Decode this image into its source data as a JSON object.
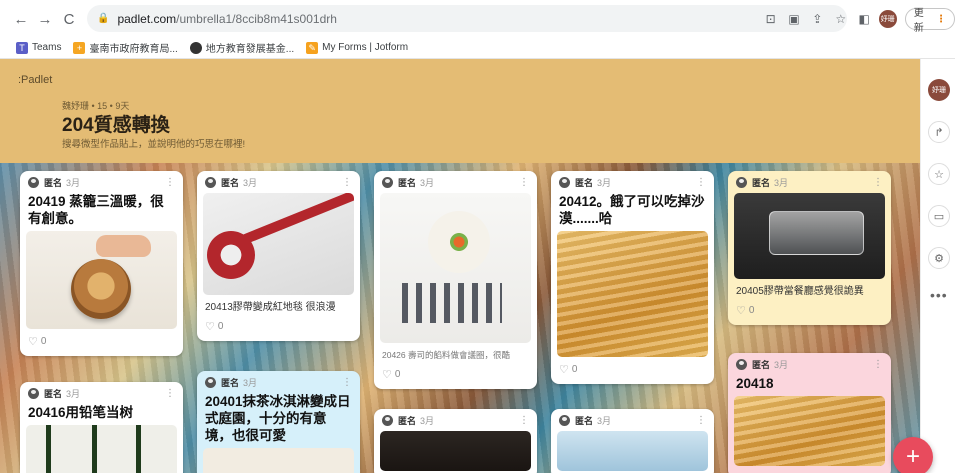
{
  "browser": {
    "url_host": "padlet.com",
    "url_path": "/umbrella1/8ccib8m41s001drh",
    "profile_label": "妤珊",
    "update_label": "更新",
    "bookmarks": [
      {
        "label": "Teams",
        "color": "#5b5fc7"
      },
      {
        "label": "臺南市政府教育局...",
        "color": "#f5a623"
      },
      {
        "label": "地方教育發展基金...",
        "color": "#333333"
      },
      {
        "label": "My Forms | Jotform",
        "color": "#f6a21e"
      }
    ]
  },
  "padlet": {
    "logo": ":Padlet",
    "meta": "魏妤珊 • 15 • 9天",
    "title": "204質感轉換",
    "subtitle": "搜尋微型作品貼上，並說明他的巧思在哪裡!",
    "rail_avatar": "妤珊",
    "fab": "+"
  },
  "cards": [
    {
      "author": "匿名",
      "time": "3月",
      "title": "20419 蒸籠三溫暖，很有創意。",
      "caption": "",
      "likes": "0"
    },
    {
      "author": "匿名",
      "time": "3月",
      "title": "",
      "caption": "20413膠帶變成紅地毯 很浪漫",
      "likes": "0"
    },
    {
      "author": "匿名",
      "time": "3月",
      "title": "",
      "caption": "20426 壽司的餡料做會議圈，很酷",
      "likes": "0"
    },
    {
      "author": "匿名",
      "time": "3月",
      "title": "20412。餓了可以吃掉沙漠.......哈",
      "caption": "",
      "likes": "0"
    },
    {
      "author": "匿名",
      "time": "3月",
      "title": "",
      "caption": "20405膠帶當餐廳感覺很詭異",
      "likes": "0"
    },
    {
      "author": "匿名",
      "time": "3月",
      "title": "20416用铅笔当树",
      "caption": "",
      "likes": ""
    },
    {
      "author": "匿名",
      "time": "3月",
      "title": "20401抹茶冰淇淋變成日式庭園，十分的有意境，也很可愛",
      "caption": "",
      "likes": ""
    },
    {
      "author": "匿名",
      "time": "3月",
      "title": "",
      "caption": "",
      "likes": ""
    },
    {
      "author": "匿名",
      "time": "3月",
      "title": "",
      "caption": "",
      "likes": ""
    },
    {
      "author": "匿名",
      "time": "3月",
      "title": "20418",
      "caption": "",
      "likes": ""
    }
  ]
}
